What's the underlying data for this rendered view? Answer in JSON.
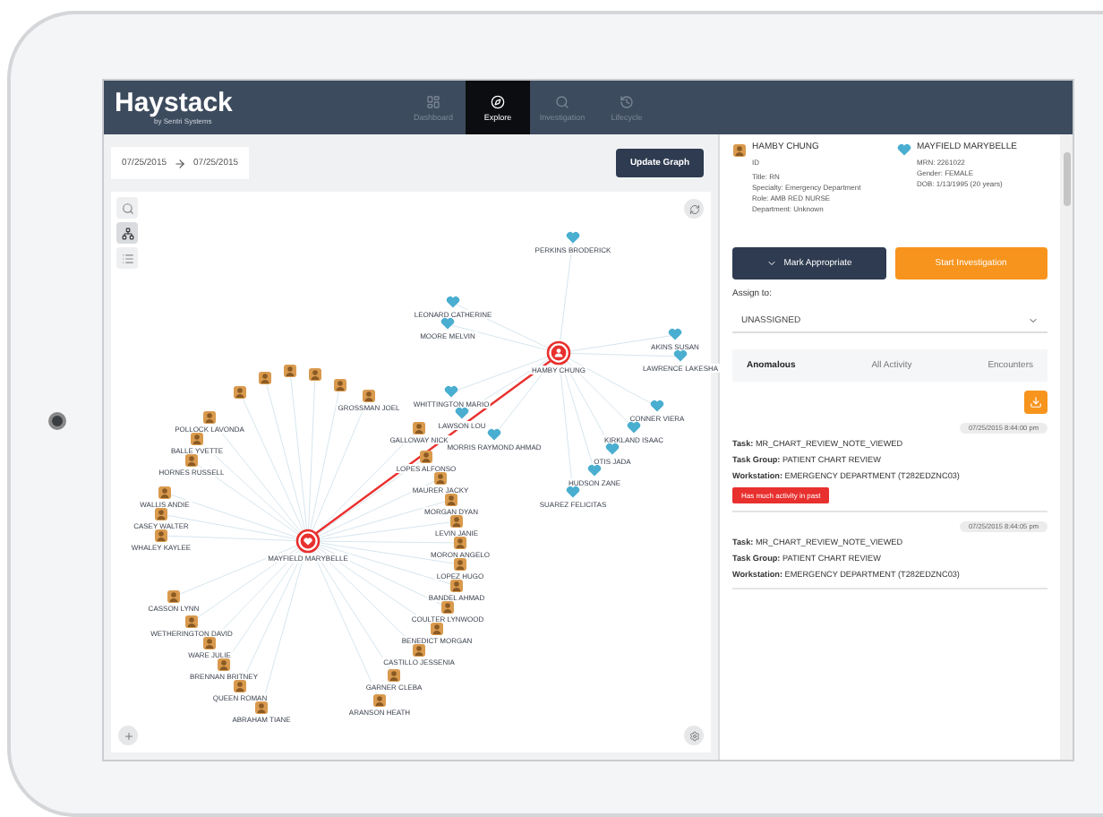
{
  "app": {
    "logo": "Haystack",
    "tagline": "by Sentri Systems"
  },
  "nav": [
    {
      "label": "Dashboard",
      "kind": "dashboard",
      "selected": false
    },
    {
      "label": "Explore",
      "kind": "explore",
      "selected": true
    },
    {
      "label": "Investigation",
      "kind": "investigation",
      "selected": false
    },
    {
      "label": "Lifecycle",
      "kind": "history",
      "selected": false
    }
  ],
  "date_range": {
    "from": "07/25/2015",
    "to": "07/25/2015"
  },
  "update_button": "Update Graph",
  "graph_tools": [
    {
      "kind": "search",
      "selected": false
    },
    {
      "kind": "hierarchy",
      "selected": true
    },
    {
      "kind": "list",
      "selected": false
    }
  ],
  "graph": {
    "nodes": [
      {
        "label": "PERKINS BRODERICK",
        "kind": "patient",
        "selected": false
      },
      {
        "label": "LEONARD CATHERINE",
        "kind": "patient",
        "selected": false
      },
      {
        "label": "MOORE MELVIN",
        "kind": "patient",
        "selected": false
      },
      {
        "label": "AKINS SUSAN",
        "kind": "patient",
        "selected": false
      },
      {
        "label": "LAWRENCE LAKESHA",
        "kind": "patient",
        "selected": false
      },
      {
        "label": "CONNER VIERA",
        "kind": "patient",
        "selected": false
      },
      {
        "label": "KIRKLAND ISAAC",
        "kind": "patient",
        "selected": false
      },
      {
        "label": "OTIS JADA",
        "kind": "patient",
        "selected": false
      },
      {
        "label": "HUDSON ZANE",
        "kind": "patient",
        "selected": false
      },
      {
        "label": "SUAREZ FELICITAS",
        "kind": "patient",
        "selected": false
      },
      {
        "label": "WHITTINGTON MARIO",
        "kind": "patient",
        "selected": false
      },
      {
        "label": "LAWSON LOU",
        "kind": "patient",
        "selected": false
      },
      {
        "label": "MORRIS RAYMOND AHMAD",
        "kind": "patient",
        "selected": false
      },
      {
        "label": "HAMBY CHUNG",
        "kind": "staff",
        "selected": true
      },
      {
        "label": "MAYFIELD MARYBELLE",
        "kind": "patient",
        "selected": true
      },
      {
        "label": "POLLOCK LAVONDA",
        "kind": "staff",
        "selected": false
      },
      {
        "label": "BALLE YVETTE",
        "kind": "staff",
        "selected": false
      },
      {
        "label": "HORNES RUSSELL",
        "kind": "staff",
        "selected": false
      },
      {
        "kind": "staff",
        "selected": false
      },
      {
        "kind": "staff",
        "selected": false
      },
      {
        "kind": "staff",
        "selected": false
      },
      {
        "kind": "staff",
        "selected": false
      },
      {
        "kind": "staff",
        "selected": false
      },
      {
        "label": "GROSSMAN JOEL",
        "kind": "staff",
        "selected": false
      },
      {
        "label": "GALLOWAY NICK",
        "kind": "staff",
        "selected": false
      },
      {
        "label": "LOPES ALFONSO",
        "kind": "staff",
        "selected": false
      },
      {
        "label": "MAURER JACKY",
        "kind": "staff",
        "selected": false
      },
      {
        "label": "MORGAN DYAN",
        "kind": "staff",
        "selected": false
      },
      {
        "label": "LEVIN JANIE",
        "kind": "staff",
        "selected": false
      },
      {
        "label": "MORON ANGELO",
        "kind": "staff",
        "selected": false
      },
      {
        "label": "LOPEZ HUGO",
        "kind": "staff",
        "selected": false
      },
      {
        "label": "BANDEL AHMAD",
        "kind": "staff",
        "selected": false
      },
      {
        "label": "COULTER LYNWOOD",
        "kind": "staff",
        "selected": false
      },
      {
        "label": "BENEDICT MORGAN",
        "kind": "staff",
        "selected": false
      },
      {
        "label": "CASTILLO JESSENIA",
        "kind": "staff",
        "selected": false
      },
      {
        "label": "GARNER CLEBA",
        "kind": "staff",
        "selected": false
      },
      {
        "label": "ARANSON HEATH",
        "kind": "staff",
        "selected": false
      },
      {
        "label": "WALLIS ANDIE",
        "kind": "staff",
        "selected": false
      },
      {
        "label": "CASEY WALTER",
        "kind": "staff",
        "selected": false
      },
      {
        "label": "WHALEY KAYLEE",
        "kind": "staff",
        "selected": false
      },
      {
        "label": "CASSON LYNN",
        "kind": "staff",
        "selected": false
      },
      {
        "label": "WETHERINGTON DAVID",
        "kind": "staff",
        "selected": false
      },
      {
        "label": "WARE JULIE",
        "kind": "staff",
        "selected": false
      },
      {
        "label": "BRENNAN BRITNEY",
        "kind": "staff",
        "selected": false
      },
      {
        "label": "QUEEN ROMAN",
        "kind": "staff",
        "selected": false
      },
      {
        "label": "ABRAHAM TIANE",
        "kind": "staff",
        "selected": false
      }
    ]
  },
  "people": [
    {
      "kind": "staff",
      "name": "HAMBY CHUNG",
      "id": "ID",
      "details": [
        "Title: RN",
        "Specialty: Emergency Department",
        "Role: AMB RED NURSE",
        "Department: Unknown"
      ]
    },
    {
      "kind": "patient",
      "name": "MAYFIELD MARYBELLE",
      "details": [
        "MRN: 2261022",
        "Gender: FEMALE",
        "DOB: 1/13/1995 (20 years)"
      ]
    }
  ],
  "actions": [
    {
      "kind": "dropdown",
      "label": "Mark Appropriate"
    },
    {
      "kind": "primary",
      "label": "Start Investigation"
    }
  ],
  "assign": {
    "label": "Assign to:",
    "value": "UNASSIGNED"
  },
  "tabs": [
    {
      "label": "Anomalous",
      "selected": true
    },
    {
      "label": "All Activity",
      "selected": false
    },
    {
      "label": "Encounters",
      "selected": false
    }
  ],
  "events": [
    {
      "timestamp": "07/25/2015 8:44:00 pm",
      "fields": [
        {
          "key": "Task:",
          "value": "MR_CHART_REVIEW_NOTE_VIEWED"
        },
        {
          "key": "Task Group:",
          "value": "PATIENT CHART REVIEW"
        },
        {
          "key": "Workstation:",
          "value": "EMERGENCY DEPARTMENT (T282EDZNC03)"
        }
      ],
      "flag": "Has much activity in past"
    },
    {
      "timestamp": "07/25/2015 8:44:05 pm",
      "fields": [
        {
          "key": "Task:",
          "value": "MR_CHART_REVIEW_NOTE_VIEWED"
        },
        {
          "key": "Task Group:",
          "value": "PATIENT CHART REVIEW"
        },
        {
          "key": "Workstation:",
          "value": "EMERGENCY DEPARTMENT (T282EDZNC03)"
        }
      ]
    }
  ]
}
